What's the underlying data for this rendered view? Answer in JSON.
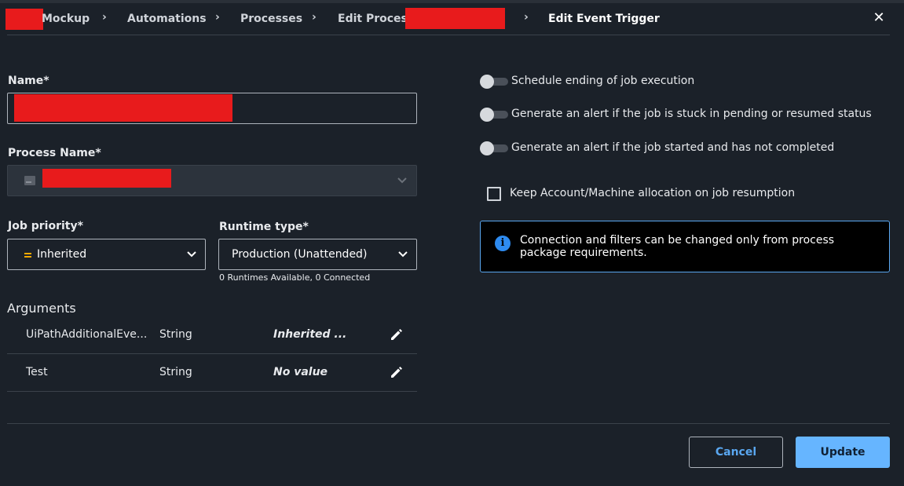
{
  "breadcrumb": {
    "item1": "Mockup",
    "item2": "Automations",
    "item3": "Processes",
    "item4": "Edit Process:",
    "current": "Edit Event Trigger",
    "separator": "›",
    "close": "✕"
  },
  "form": {
    "name_label": "Name*",
    "process_name_label": "Process Name*",
    "job_priority_label": "Job priority*",
    "job_priority_value": "Inherited",
    "job_priority_icon": "equals-icon",
    "runtime_type_label": "Runtime type*",
    "runtime_type_value": "Production (Unattended)",
    "runtime_helper": "0 Runtimes Available, 0 Connected"
  },
  "arguments": {
    "title": "Arguments",
    "rows": [
      {
        "name": "UiPathAdditionalEve...",
        "type": "String",
        "value": "Inherited ..."
      },
      {
        "name": "Test",
        "type": "String",
        "value": "No value"
      }
    ]
  },
  "options": {
    "toggles": [
      {
        "label": "Schedule ending of job execution",
        "on": false
      },
      {
        "label": "Generate an alert if the job is stuck in pending or resumed status",
        "on": false
      },
      {
        "label": "Generate an alert if the job started and has not completed",
        "on": false
      }
    ],
    "checkbox_label": "Keep Account/Machine allocation on job resumption",
    "checkbox_checked": false,
    "info_icon": "i",
    "info_text": "Connection and filters can be changed only from process package requirements."
  },
  "footer": {
    "cancel": "Cancel",
    "update": "Update"
  },
  "colors": {
    "background": "#1b2129",
    "accent": "#66b5ff",
    "redaction": "#e81b1c",
    "info_border": "#5aa7f0",
    "priority_icon": "#f2a900"
  }
}
